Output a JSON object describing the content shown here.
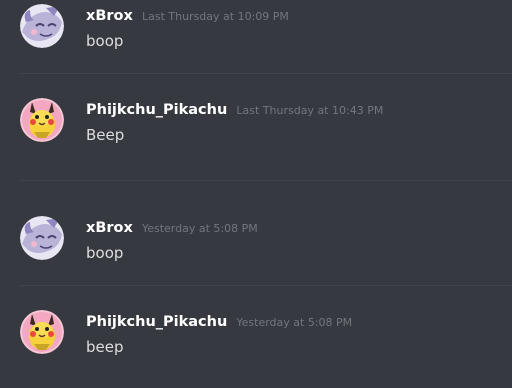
{
  "messages": [
    {
      "author": "xBrox",
      "timestamp": "Last Thursday at 10:09 PM",
      "text": "boop",
      "avatar_icon": "dragon-avatar-icon"
    },
    {
      "author": "Phijkchu_Pikachu",
      "timestamp": "Last Thursday at 10:43 PM",
      "text": "Beep",
      "avatar_icon": "pikachu-avatar-icon"
    },
    {
      "author": "xBrox",
      "timestamp": "Yesterday at 5:08 PM",
      "text": "boop",
      "avatar_icon": "dragon-avatar-icon"
    },
    {
      "author": "Phijkchu_Pikachu",
      "timestamp": "Yesterday at 5:08 PM",
      "text": "beep",
      "avatar_icon": "pikachu-avatar-icon"
    }
  ],
  "colors": {
    "background": "#36393f",
    "username": "#ffffff",
    "timestamp": "#72767d",
    "message_text": "#dcddde",
    "divider": "#40434a"
  }
}
